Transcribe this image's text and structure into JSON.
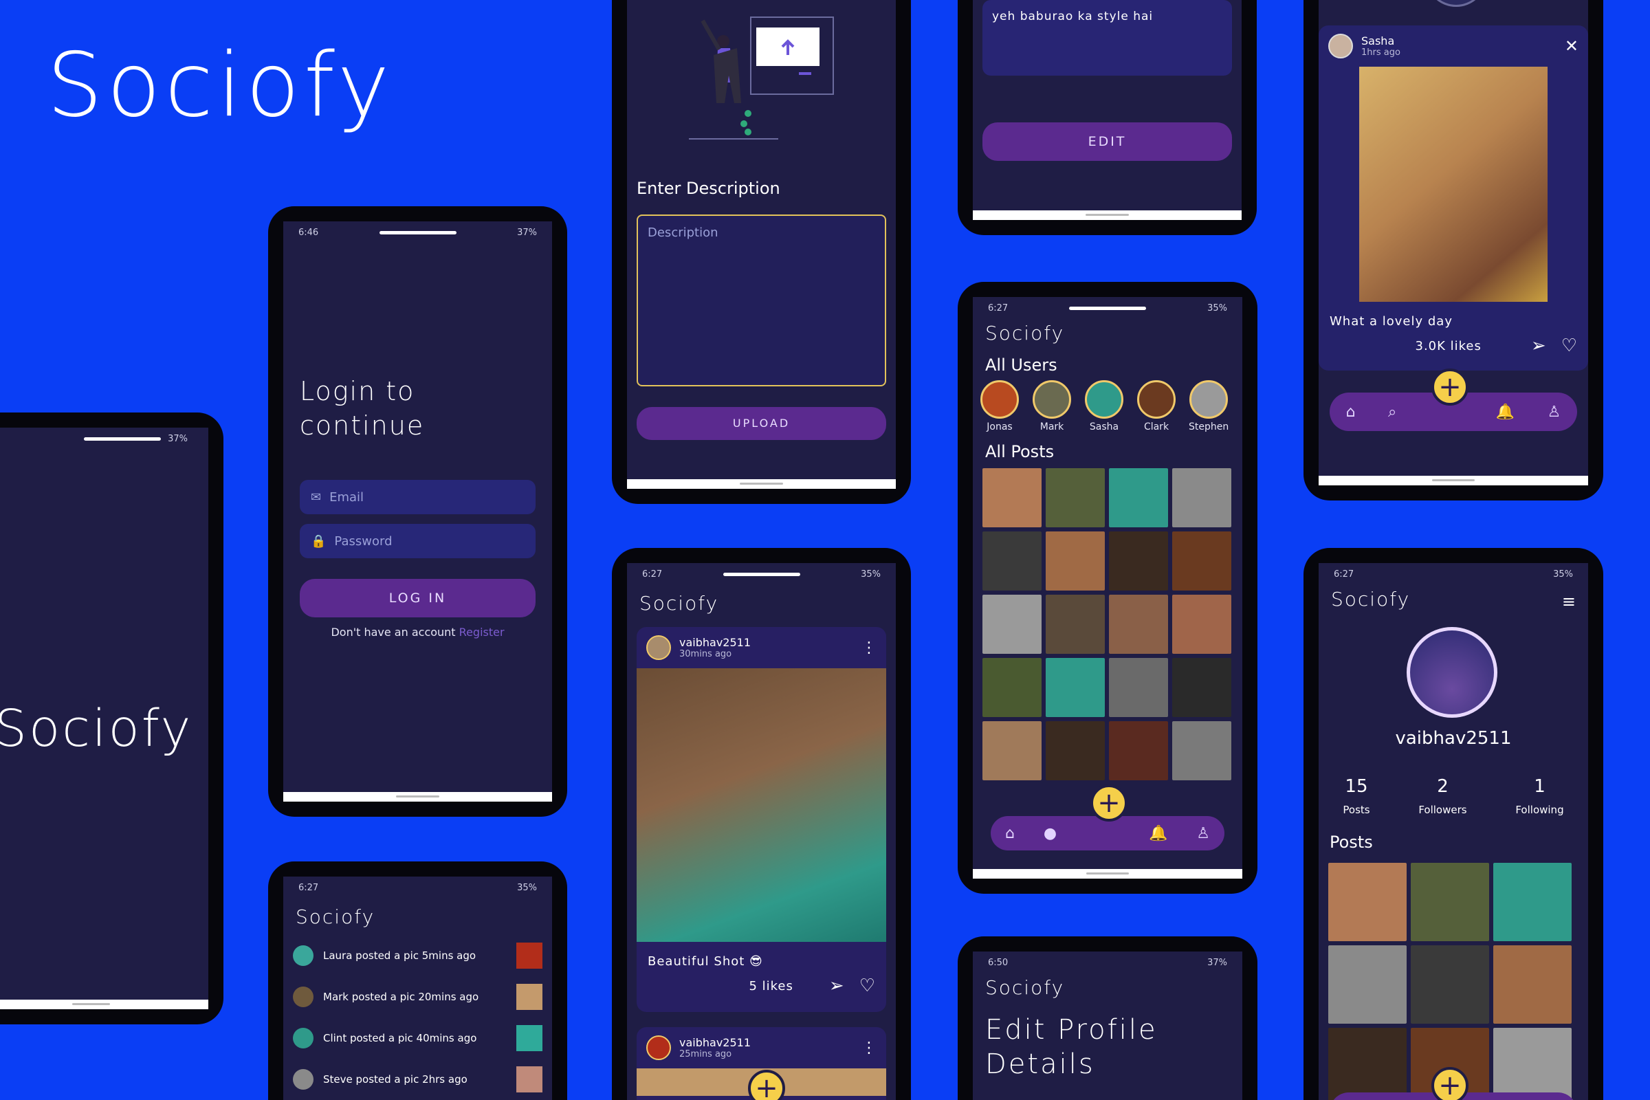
{
  "brand": "Sociofy",
  "phone_splash": {
    "status_right": "37%",
    "brand": "Sociofy"
  },
  "phone_login": {
    "status_time": "6:46",
    "status_right": "37%",
    "heading_line1": "Login to",
    "heading_line2": "continue",
    "email_placeholder": "Email",
    "password_placeholder": "Password",
    "login_button": "LOG IN",
    "footer_text": "Don't have an account",
    "register_link": "Register"
  },
  "phone_notifications": {
    "status_time": "6:27",
    "status_right": "35%",
    "title": "Sociofy",
    "items": [
      {
        "text": "Laura posted a pic 5mins ago"
      },
      {
        "text": "Mark posted a pic 20mins ago"
      },
      {
        "text": "Clint posted a pic 40mins ago"
      },
      {
        "text": "Steve posted a pic 2hrs ago"
      }
    ]
  },
  "phone_upload": {
    "section_label": "Enter Description",
    "description_placeholder": "Description",
    "upload_button": "UPLOAD"
  },
  "phone_feed": {
    "status_time": "6:27",
    "status_right": "35%",
    "title": "Sociofy",
    "post1": {
      "username": "vaibhav2511",
      "time": "30mins ago",
      "caption": "Beautiful Shot 😎",
      "likes": "5 likes"
    },
    "post2": {
      "username": "vaibhav2511",
      "time": "25mins ago"
    }
  },
  "phone_edit_post": {
    "caption_value": "yeh baburao ka style hai",
    "edit_button": "EDIT"
  },
  "phone_explore": {
    "status_time": "6:27",
    "status_right": "35%",
    "title": "Sociofy",
    "all_users_label": "All Users",
    "users": [
      "Jonas",
      "Mark",
      "Sasha",
      "Clark",
      "Stephen"
    ],
    "all_posts_label": "All Posts"
  },
  "phone_edit_profile": {
    "status_time": "6:50",
    "status_right": "37%",
    "title": "Sociofy",
    "heading_line1": "Edit Profile",
    "heading_line2": "Details"
  },
  "phone_post_detail": {
    "username": "Sasha",
    "time": "1hrs ago",
    "caption": "What a lovely day",
    "likes": "3.0K likes"
  },
  "phone_profile": {
    "status_time": "6:27",
    "status_right": "35%",
    "title": "Sociofy",
    "username": "vaibhav2511",
    "stats": [
      {
        "value": "15",
        "label": "Posts"
      },
      {
        "value": "2",
        "label": "Followers"
      },
      {
        "value": "1",
        "label": "Following"
      }
    ],
    "posts_label": "Posts"
  },
  "colors": {
    "background": "#0a3ef5",
    "screen": "#1f1d45",
    "card": "#271f63",
    "accent": "#5b2a8f",
    "fab": "#f5cf4a",
    "link": "#7c5ccf"
  }
}
